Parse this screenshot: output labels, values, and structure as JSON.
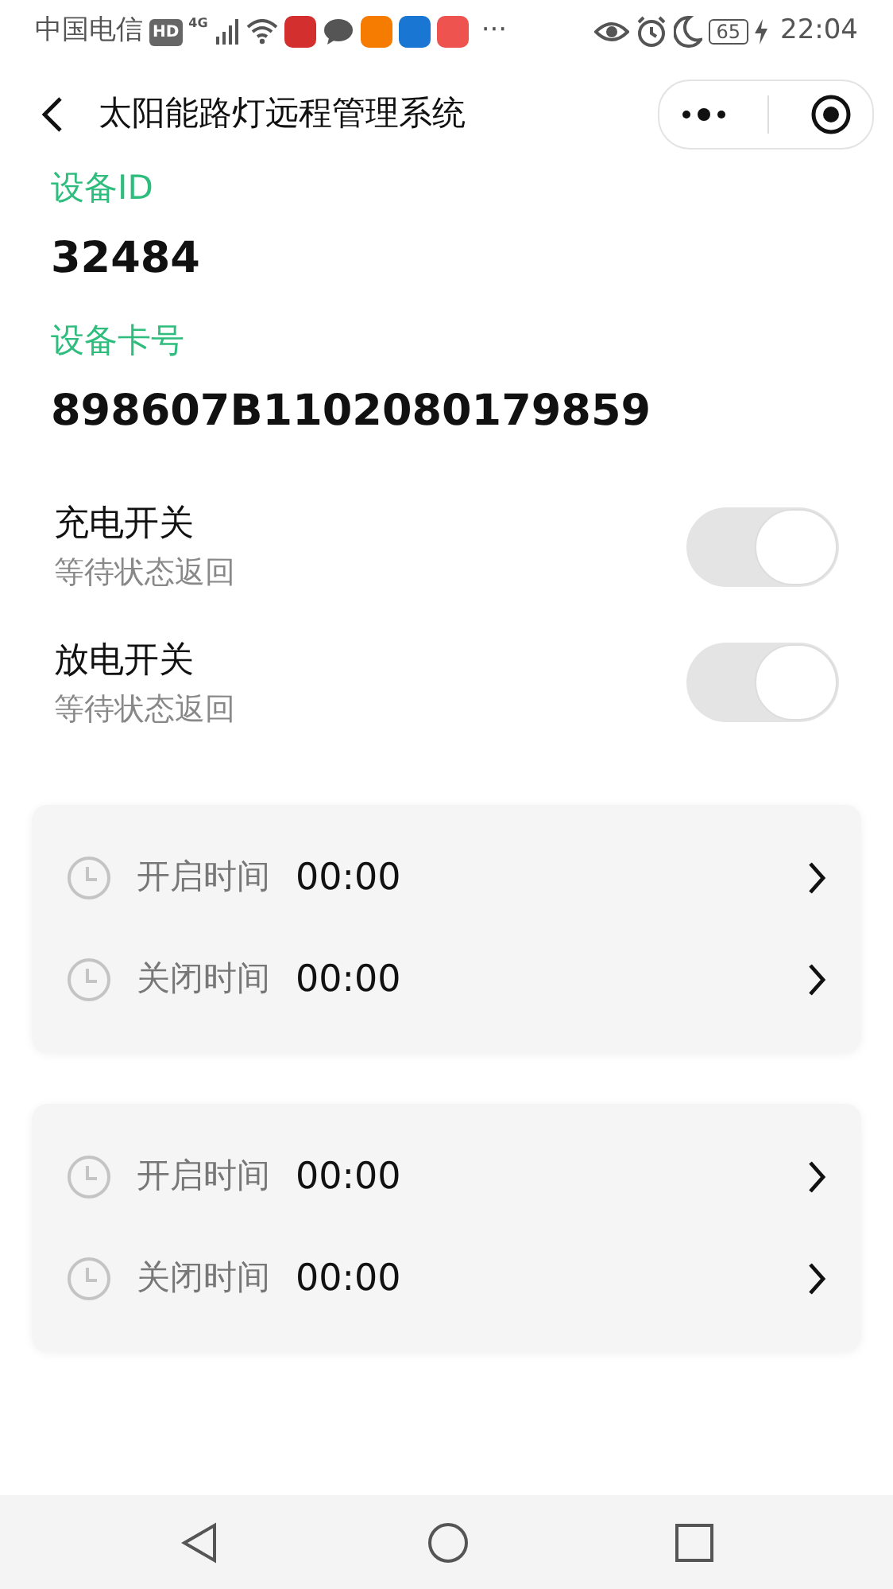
{
  "status_bar": {
    "carrier": "中国电信",
    "hd": "HD",
    "network": "4G",
    "more": "···",
    "battery": "65",
    "time": "22:04"
  },
  "header": {
    "title": "太阳能路灯远程管理系统"
  },
  "fields": [
    {
      "label": "设备ID",
      "value": "32484"
    },
    {
      "label": "设备卡号",
      "value": "898607B1102080179859"
    }
  ],
  "switches": [
    {
      "title": "充电开关",
      "status": "等待状态返回",
      "on": true,
      "disabled": true
    },
    {
      "title": "放电开关",
      "status": "等待状态返回",
      "on": true,
      "disabled": true
    }
  ],
  "schedules": [
    {
      "rows": [
        {
          "label": "开启时间",
          "value": "00:00"
        },
        {
          "label": "关闭时间",
          "value": "00:00"
        }
      ]
    },
    {
      "rows": [
        {
          "label": "开启时间",
          "value": "00:00"
        },
        {
          "label": "关闭时间",
          "value": "00:00"
        }
      ]
    }
  ]
}
